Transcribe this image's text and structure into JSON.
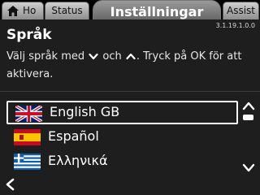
{
  "tabs": {
    "home": "Ho",
    "status": "Status",
    "active": "Inställningar",
    "assist": "Assist"
  },
  "version": "3.1.19.1.0.0",
  "page_title": "Språk",
  "instruction": {
    "part1": "Välj språk med",
    "part2": "och",
    "part3": ". Tryck på OK för att aktivera."
  },
  "languages": [
    {
      "label": "English GB",
      "flag": "uk-flag-icon",
      "selected": true
    },
    {
      "label": "Español",
      "flag": "spain-flag-icon",
      "selected": false
    },
    {
      "label": "Ελληνικά",
      "flag": "greece-flag-icon",
      "selected": false
    }
  ],
  "icons": {
    "home": "home-icon",
    "down": "chevron-down-icon",
    "up": "chevron-up-icon",
    "back": "chevron-left-icon"
  },
  "colors": {
    "background": "#1e1e1e",
    "active_tab": "#7a7a7a",
    "inactive_tab": "#b0b0b0",
    "text": "#ffffff"
  }
}
